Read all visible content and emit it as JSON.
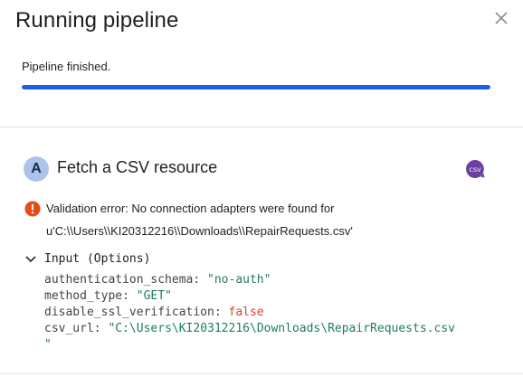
{
  "dialog": {
    "title": "Running pipeline",
    "close_icon": "close-icon"
  },
  "pipeline": {
    "status": "Pipeline finished.",
    "progress_percent": 100,
    "progress_color": "#1a5fe0"
  },
  "step": {
    "avatar_letter": "A",
    "title": "Fetch a CSV resource",
    "badge_icon": "csv-icon",
    "badge_text": "CSV",
    "badge_color": "#6b3fa0"
  },
  "error": {
    "icon": "error-icon",
    "color": "#e64a19",
    "line1": "Validation error: No connection adapters were found for",
    "line2": "u'C:\\\\Users\\\\KI20312216\\\\Downloads\\\\RepairRequests.csv'"
  },
  "input": {
    "header": "Input (Options)",
    "rows": [
      {
        "key": "authentication_schema:",
        "value": "\"no-auth\"",
        "kind": "string"
      },
      {
        "key": "method_type:",
        "value": "\"GET\"",
        "kind": "string"
      },
      {
        "key": "disable_ssl_verification:",
        "value": "false",
        "kind": "bool"
      },
      {
        "key": "csv_url:",
        "value": "\"C:\\Users\\KI20312216\\Downloads\\RepairRequests.csv",
        "kind": "string"
      }
    ],
    "wrap_tail": "\""
  }
}
